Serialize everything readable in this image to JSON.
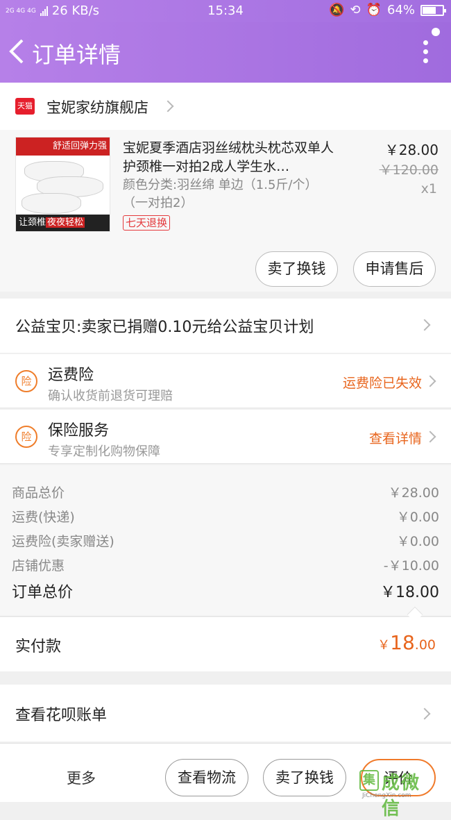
{
  "status_bar": {
    "network": "2G 4G 4G",
    "speed": "26 KB/s",
    "time": "15:34",
    "battery": "64%",
    "battery_level": 0.64
  },
  "header": {
    "title": "订单详情"
  },
  "shop": {
    "badge": "天猫",
    "name": "宝妮家纺旗舰店"
  },
  "product": {
    "image_top_text": "舒适回弹力强",
    "image_bottom_text": "让颈椎",
    "image_bottom_highlight": "夜夜轻松",
    "title": "宝妮夏季酒店羽丝绒枕头枕芯双单人护颈椎一对拍2成人学生水…",
    "spec": "颜色分类:羽丝绵 单边（1.5斤/个）（一对拍2）",
    "tag": "七天退换",
    "price": "￥28.00",
    "original_price": "￥120.00",
    "quantity": "x1",
    "buttons": [
      "卖了换钱",
      "申请售后"
    ]
  },
  "charity": {
    "text": "公益宝贝:卖家已捐赠0.10元给公益宝贝计划"
  },
  "insurance": [
    {
      "badge": "险",
      "title": "运费险",
      "subtitle": "确认收货前退货可理赔",
      "status": "运费险已失效"
    },
    {
      "badge": "险",
      "title": "保险服务",
      "subtitle": "专享定制化购物保障",
      "status": "查看详情"
    }
  ],
  "summary": [
    {
      "label": "商品总价",
      "value": "￥28.00"
    },
    {
      "label": "运费(快递)",
      "value": "￥0.00"
    },
    {
      "label": "运费险(卖家赠送)",
      "value": "￥0.00"
    },
    {
      "label": "店铺优惠",
      "value": "-￥10.00"
    },
    {
      "label": "订单总价",
      "value": "￥18.00"
    }
  ],
  "paid": {
    "label": "实付款",
    "currency": "￥",
    "integer": "18",
    "decimal": ".00"
  },
  "huabei": {
    "text": "查看花呗账单"
  },
  "bottom_bar": {
    "more": "更多",
    "buttons": [
      "查看物流",
      "卖了换钱",
      "评价"
    ]
  },
  "watermark": {
    "box": "集",
    "text": "成微信",
    "url_text": "JiChengXin.com"
  },
  "colors": {
    "header": "#a56fe0",
    "accent_orange": "#e8651d",
    "tag_red": "#e4393c"
  }
}
